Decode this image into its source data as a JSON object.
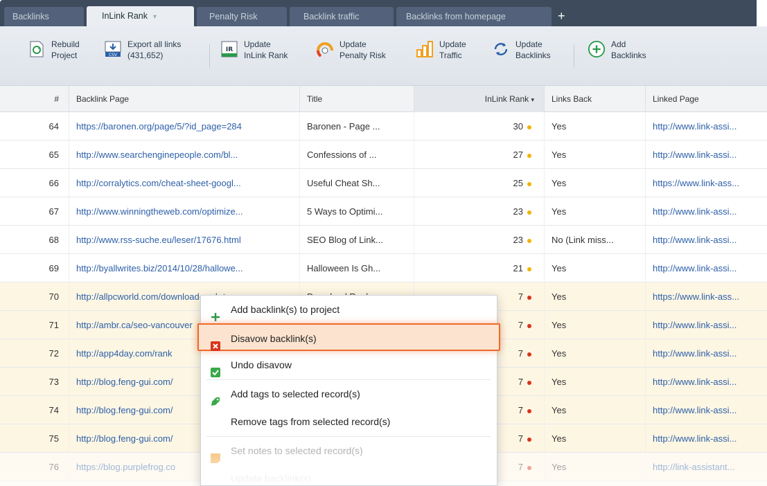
{
  "tabs": [
    {
      "label": "Backlinks"
    },
    {
      "label": "InLink Rank"
    },
    {
      "label": "Penalty Risk"
    },
    {
      "label": "Backlink traffic"
    },
    {
      "label": "Backlinks from homepage"
    }
  ],
  "toolbar": {
    "rebuild": {
      "line1": "Rebuild",
      "line2": "Project"
    },
    "export": {
      "line1": "Export all links",
      "line2": "(431,652)",
      "icon_text": "CSV"
    },
    "update_inlink": {
      "line1": "Update",
      "line2": "InLink Rank",
      "icon_text": "IR"
    },
    "update_penalty": {
      "line1": "Update",
      "line2": "Penalty Risk"
    },
    "update_traffic": {
      "line1": "Update",
      "line2": "Traffic"
    },
    "update_backlinks": {
      "line1": "Update",
      "line2": "Backlinks"
    },
    "add_backlinks": {
      "line1": "Add",
      "line2": "Backlinks"
    }
  },
  "table": {
    "headers": {
      "num": "#",
      "page": "Backlink Page",
      "title": "Title",
      "rank": "InLink Rank",
      "back": "Links Back",
      "linked": "Linked Page"
    },
    "rows": [
      {
        "num": "64",
        "page": "https://baronen.org/page/5/?id_page=284",
        "title": "Baronen - Page ...",
        "rank": "30",
        "back": "Yes",
        "linked": "http://www.link-assi..."
      },
      {
        "num": "65",
        "page": "http://www.searchenginepeople.com/bl...",
        "title": "Confessions of ...",
        "rank": "27",
        "back": "Yes",
        "linked": "http://www.link-assi..."
      },
      {
        "num": "66",
        "page": "http://corralytics.com/cheat-sheet-googl...",
        "title": "Useful Cheat Sh...",
        "rank": "25",
        "back": "Yes",
        "linked": "https://www.link-ass..."
      },
      {
        "num": "67",
        "page": "http://www.winningtheweb.com/optimize...",
        "title": "5 Ways to Optimi...",
        "rank": "23",
        "back": "Yes",
        "linked": "http://www.link-assi..."
      },
      {
        "num": "68",
        "page": "http://www.rss-suche.eu/leser/17676.html",
        "title": "SEO Blog of Link...",
        "rank": "23",
        "back": "No (Link miss...",
        "linked": "http://www.link-assi..."
      },
      {
        "num": "69",
        "page": "http://byallwrites.biz/2014/10/28/hallowe...",
        "title": "Halloween Is Gh...",
        "rank": "21",
        "back": "Yes",
        "linked": "http://www.link-assi..."
      },
      {
        "num": "70",
        "page": "http://allpcworld.com/download-rank-tra...",
        "title": "Download Rank...",
        "rank": "7",
        "back": "Yes",
        "linked": "https://www.link-ass..."
      },
      {
        "num": "71",
        "page": "http://ambr.ca/seo-vancouver",
        "title": "",
        "rank": "7",
        "back": "Yes",
        "linked": "http://www.link-assi..."
      },
      {
        "num": "72",
        "page": "http://app4day.com/rank",
        "title": "",
        "rank": "7",
        "back": "Yes",
        "linked": "http://www.link-assi..."
      },
      {
        "num": "73",
        "page": "http://blog.feng-gui.com/",
        "title": "",
        "rank": "7",
        "back": "Yes",
        "linked": "http://www.link-assi..."
      },
      {
        "num": "74",
        "page": "http://blog.feng-gui.com/",
        "title": "",
        "rank": "7",
        "back": "Yes",
        "linked": "http://www.link-assi..."
      },
      {
        "num": "75",
        "page": "http://blog.feng-gui.com/",
        "title": "",
        "rank": "7",
        "back": "Yes",
        "linked": "http://www.link-assi..."
      },
      {
        "num": "76",
        "page": "https://blog.purplefrog.co",
        "title": "",
        "rank": "7",
        "back": "Yes",
        "linked": "http://link-assistant..."
      }
    ]
  },
  "context_menu": {
    "add_backlinks": "Add backlink(s) to project",
    "disavow": "Disavow backlink(s)",
    "undo_disavow": "Undo disavow",
    "add_tags": "Add tags to selected record(s)",
    "remove_tags": "Remove tags from selected record(s)",
    "set_notes": "Set notes to selected record(s)",
    "update_backlinks": "Update backlink(s)"
  },
  "colors": {
    "dot_yellow": "#f0b400",
    "dot_red": "#d9341c",
    "highlight_row": "#fdf6e3",
    "accent": "#ee6a2a"
  }
}
